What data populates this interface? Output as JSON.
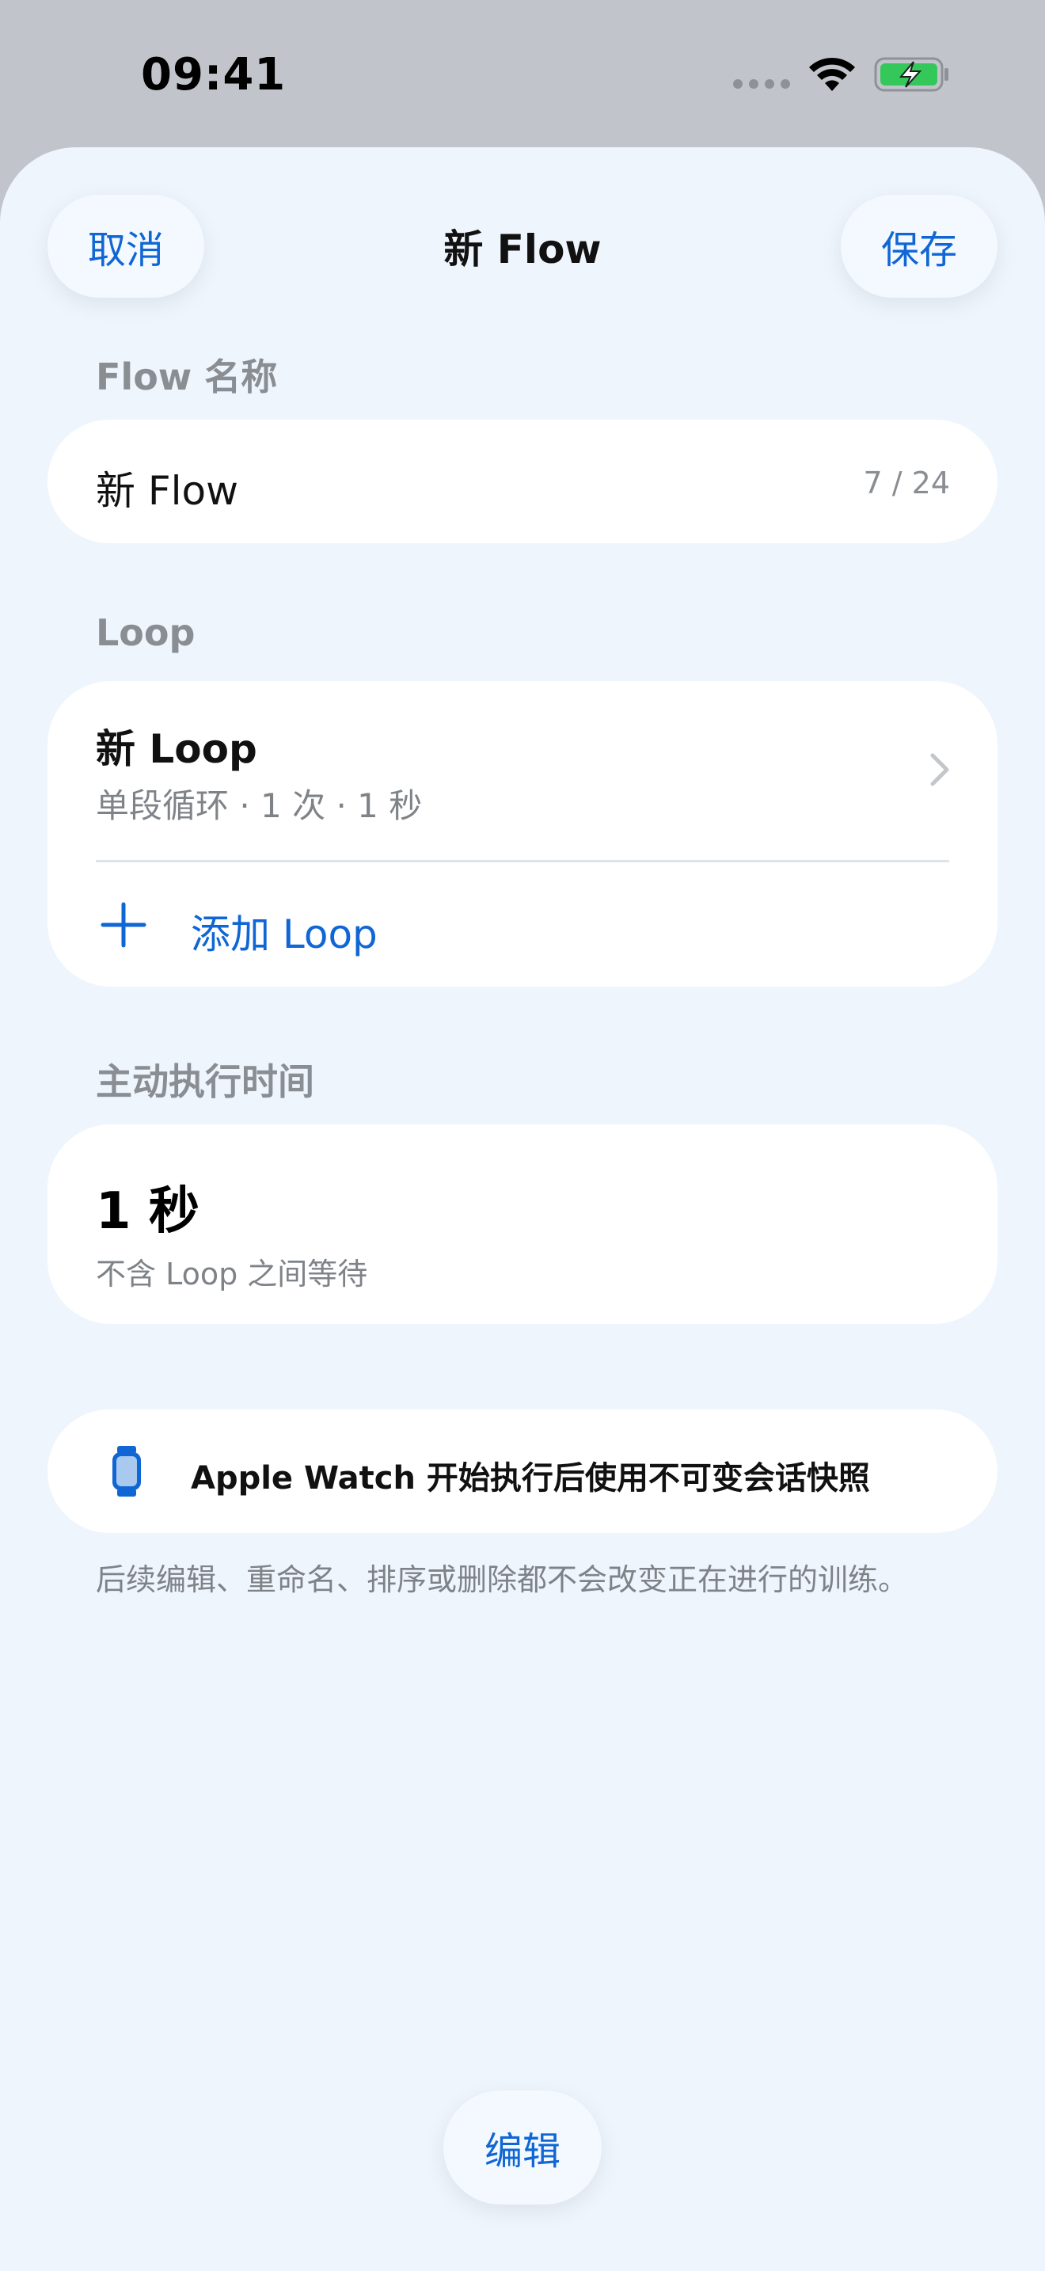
{
  "status_bar": {
    "time": "09:41"
  },
  "nav": {
    "cancel_label": "取消",
    "title": "新 Flow",
    "save_label": "保存"
  },
  "flow_name": {
    "section_label": "Flow 名称",
    "value": "新 Flow",
    "count": "7 / 24"
  },
  "loops": {
    "section_label": "Loop",
    "items": [
      {
        "title": "新 Loop",
        "subtitle": "单段循环 · 1 次 · 1 秒"
      }
    ],
    "add_label": "添加 Loop"
  },
  "active_time": {
    "section_label": "主动执行时间",
    "value": "1 秒",
    "note": "不含 Loop 之间等待"
  },
  "watch_notice": {
    "text": "Apple Watch 开始执行后使用不可变会话快照",
    "footnote": "后续编辑、重命名、排序或删除都不会改变正在进行的训练。"
  },
  "footer": {
    "edit_label": "编辑"
  },
  "colors": {
    "accent": "#1066d4",
    "sheet_bg": "#eef5fd",
    "battery_fill": "#34c759"
  },
  "icons": [
    "signal-icon",
    "wifi-icon",
    "battery-charging-icon",
    "chevron-right-icon",
    "plus-icon",
    "watch-icon"
  ]
}
